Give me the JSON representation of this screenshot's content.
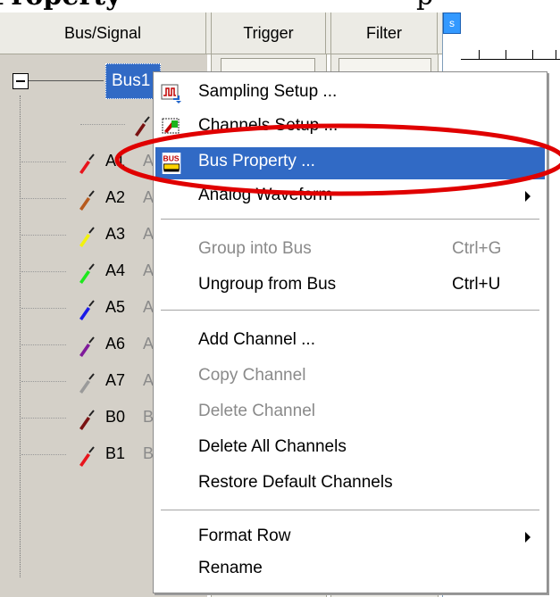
{
  "caption": {
    "left": "Property",
    "right": "p"
  },
  "header": {
    "bus_signal": "Bus/Signal",
    "trigger": "Trigger",
    "filter": "Filter"
  },
  "wave": {
    "marker": "s"
  },
  "tree": {
    "bus": "Bus1",
    "rows": [
      {
        "label": "A1",
        "suffix": "A",
        "color": "#e8141c"
      },
      {
        "label": "A2",
        "suffix": "A",
        "color": "#b75a1d"
      },
      {
        "label": "A3",
        "suffix": "A",
        "color": "#f2f20d"
      },
      {
        "label": "A4",
        "suffix": "A",
        "color": "#1de81d"
      },
      {
        "label": "A5",
        "suffix": "A",
        "color": "#1a1ae8"
      },
      {
        "label": "A6",
        "suffix": "A",
        "color": "#7f1a9a"
      },
      {
        "label": "A7",
        "suffix": "A",
        "color": "#9a9a9a"
      },
      {
        "label": "B0",
        "suffix": "B",
        "color": "#7a1212"
      },
      {
        "label": "B1",
        "suffix": "B",
        "color": "#e8141c"
      }
    ],
    "first_child_color": "#7a1212"
  },
  "menu": {
    "items": [
      {
        "label": "Sampling Setup ...",
        "icon": "sampling-setup-icon"
      },
      {
        "label": "Channels Setup ...",
        "icon": "channels-setup-icon"
      },
      {
        "label": "Bus Property ...",
        "icon": "bus-property-icon",
        "selected": true
      },
      {
        "label": "Analog Waveform",
        "submenu": true
      },
      {
        "label": "Group into Bus",
        "shortcut": "Ctrl+G",
        "disabled": true
      },
      {
        "label": "Ungroup from Bus",
        "shortcut": "Ctrl+U"
      },
      {
        "label": "Add Channel ..."
      },
      {
        "label": "Copy Channel",
        "disabled": true
      },
      {
        "label": "Delete Channel",
        "disabled": true
      },
      {
        "label": "Delete All Channels"
      },
      {
        "label": "Restore Default Channels"
      },
      {
        "label": "Format Row",
        "submenu": true
      },
      {
        "label": "Rename"
      }
    ],
    "icon_text": "BUS"
  },
  "colors": {
    "selection": "#316ac5",
    "annotation": "#e00000"
  }
}
